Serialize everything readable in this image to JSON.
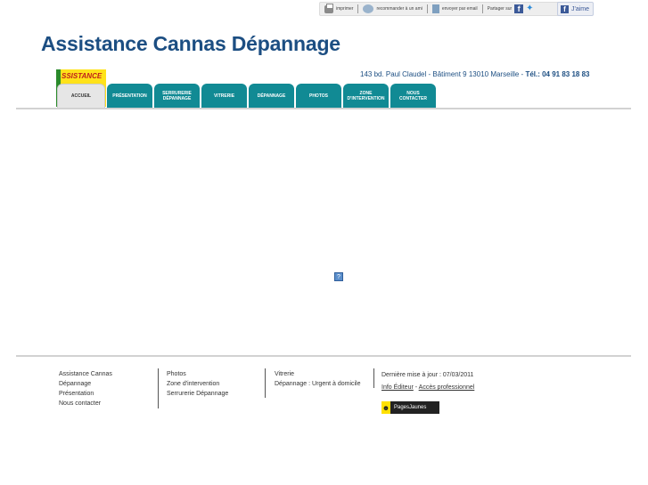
{
  "topbar": {
    "print_label": "imprimer",
    "recommend_label": "recommander à un ami",
    "send_label": "envoyer par email",
    "share_label": "Partager sur",
    "like_label": "J'aime"
  },
  "site": {
    "title": "Assistance Cannas Dépannage",
    "address": "143 bd. Paul Claudel - Bâtiment 9 13010 Marseille  -  ",
    "phone": "Tél.: 04 91 83 18 83",
    "logo_text": "SSISTANCE"
  },
  "nav": {
    "tabs": [
      {
        "label": "ACCUEIL"
      },
      {
        "label": "PRÉSENTATION"
      },
      {
        "label": "SERRURERIE\nDÉPANNAGE"
      },
      {
        "label": "VITRERIE"
      },
      {
        "label": "DÉPANNAGE"
      },
      {
        "label": "PHOTOS"
      },
      {
        "label": "ZONE\nD'INTERVENTION"
      },
      {
        "label": "NOUS\nCONTACTER"
      }
    ]
  },
  "placeholder": "?",
  "footer": {
    "col1": [
      "Assistance Cannas",
      "Dépannage",
      "Présentation",
      "Nous contacter"
    ],
    "col2": [
      "Photos",
      "Zone d'intervention",
      "Serrurerie Dépannage"
    ],
    "col3": [
      "Vitrerie",
      "Dépannage : Urgent à domicile"
    ],
    "updated": "Dernière mise à jour : 07/03/2011",
    "info_editeur": "Info Éditeur",
    "sep": " - ",
    "acces_pro": "Accès professionnel",
    "pj_label": "PagesJaunes"
  },
  "colors": {
    "brand": "#1c4e82",
    "tab": "#118a94",
    "logo_yellow": "#ffe21a"
  }
}
